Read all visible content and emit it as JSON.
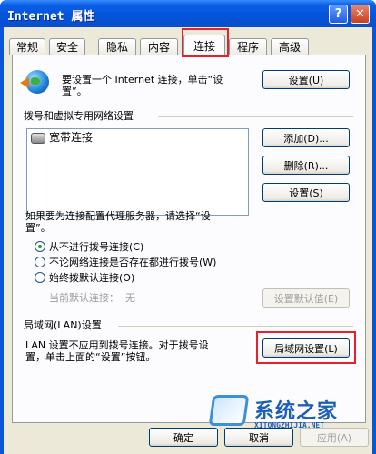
{
  "window": {
    "title": "Internet 属性",
    "help_label": "?",
    "close_label": "✕"
  },
  "tabs": [
    {
      "label": "常规"
    },
    {
      "label": "安全"
    },
    {
      "label": "隐私"
    },
    {
      "label": "内容"
    },
    {
      "label": "连接",
      "active": true
    },
    {
      "label": "程序"
    },
    {
      "label": "高级"
    }
  ],
  "setup": {
    "text_line1": "要设置一个 Internet 连接，单击“设",
    "text_line2": "置”。",
    "button": "设置(U)"
  },
  "dialup": {
    "group_title": "拨号和虚拟专用网络设置",
    "connections": [
      "宽带连接"
    ],
    "add_button": "添加(D)...",
    "remove_button": "删除(R)...",
    "settings_button": "设置(S)"
  },
  "proxy": {
    "text_line1": "如果要为连接配置代理服务器，请选择“设",
    "text_line2": "置”。",
    "options": [
      {
        "label": "从不进行拨号连接(C)",
        "checked": true
      },
      {
        "label": "不论网络连接是否存在都进行拨号(W)",
        "checked": false
      },
      {
        "label": "始终拨默认连接(O)",
        "checked": false
      }
    ],
    "current_default_label": "当前默认连接：",
    "current_default_value": "无",
    "set_default_button": "设置默认值(E)"
  },
  "lan": {
    "group_title": "局域网(LAN)设置",
    "text_line1": "LAN 设置不应用到拨号连接。对于拨号设",
    "text_line2": "置，单击上面的“设置”按钮。",
    "button": "局域网设置(L)"
  },
  "footer": {
    "ok": "确定",
    "cancel": "取消",
    "apply": "应用(A)"
  },
  "watermark": {
    "title": "系统之家",
    "subtitle": "XITONGZHIJIA.NET"
  },
  "colors": {
    "highlight": "#e8202a",
    "titlebar": "#0554d9",
    "dialog_bg": "#ece9d8"
  }
}
